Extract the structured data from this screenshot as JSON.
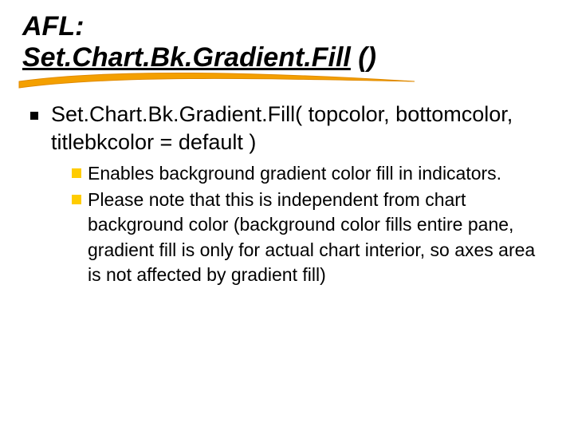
{
  "title": {
    "line1": "AFL:",
    "fn_underlined": "Set.Chart.Bk.Gradient.Fill",
    "fn_suffix": " ()"
  },
  "signature": "Set.Chart.Bk.Gradient.Fill( topcolor, bottomcolor, titlebkcolor = default )",
  "points": {
    "p1": "Enables background gradient color fill in indicators.",
    "p2": "Please note that this is independent from chart background color (background color fills entire pane, gradient fill is only for actual chart interior, so axes area is not affected by gradient fill)"
  }
}
